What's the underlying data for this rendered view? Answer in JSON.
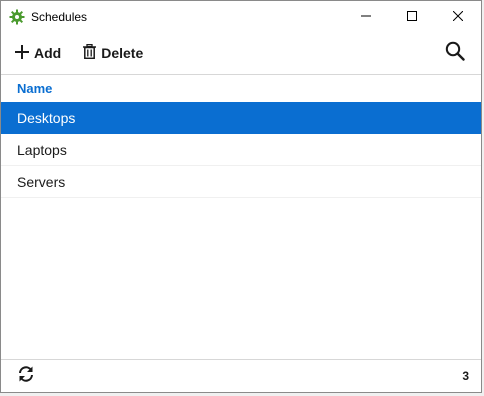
{
  "window": {
    "title": "Schedules",
    "icon": "gear-icon",
    "controls": [
      "minimize-icon",
      "maximize-icon",
      "close-icon"
    ]
  },
  "toolbar": {
    "add_label": "Add",
    "add_icon": "plus-icon",
    "delete_label": "Delete",
    "delete_icon": "trash-icon",
    "search_icon": "search-icon"
  },
  "table": {
    "column_header": "Name",
    "rows": [
      {
        "name": "Desktops",
        "selected": true
      },
      {
        "name": "Laptops",
        "selected": false
      },
      {
        "name": "Servers",
        "selected": false
      }
    ]
  },
  "status": {
    "refresh_icon": "refresh-icon",
    "count": "3"
  },
  "colors": {
    "accent": "#0a6ed1",
    "app_icon": "#4a9a2e",
    "selected_text": "#ffffff"
  }
}
